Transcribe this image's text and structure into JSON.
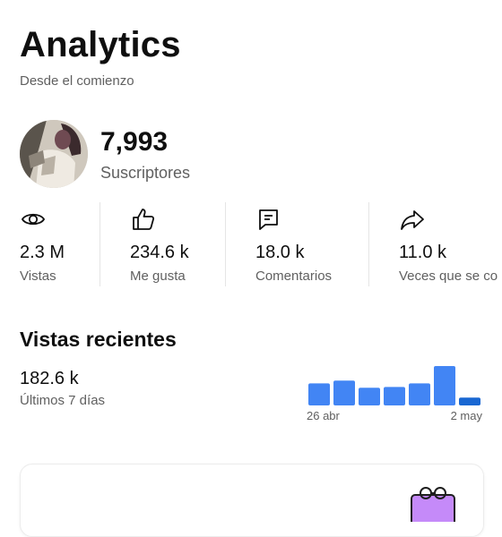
{
  "header": {
    "title": "Analytics",
    "subtitle": "Desde el comienzo"
  },
  "channel": {
    "subscribers": "7,993",
    "subscribers_label": "Suscriptores"
  },
  "stats": [
    {
      "icon": "eye-icon",
      "value": "2.3 M",
      "label": "Vistas"
    },
    {
      "icon": "thumbs-up-icon",
      "value": "234.6 k",
      "label": "Me gusta"
    },
    {
      "icon": "comment-icon",
      "value": "18.0 k",
      "label": "Comentarios"
    },
    {
      "icon": "share-icon",
      "value": "11.0 k",
      "label": "Veces que se co"
    }
  ],
  "recent": {
    "title": "Vistas recientes",
    "value": "182.6 k",
    "period": "Últimos 7 días"
  },
  "chart_data": {
    "type": "bar",
    "categories": [
      "26 abr",
      "",
      "",
      "",
      "",
      "",
      "2 may"
    ],
    "values": [
      0.56,
      0.63,
      0.45,
      0.47,
      0.56,
      1.0,
      0.2
    ],
    "xlabel": "",
    "ylabel": "",
    "colors": {
      "bar": "#4285f4",
      "highlight": "#1967d2"
    }
  }
}
